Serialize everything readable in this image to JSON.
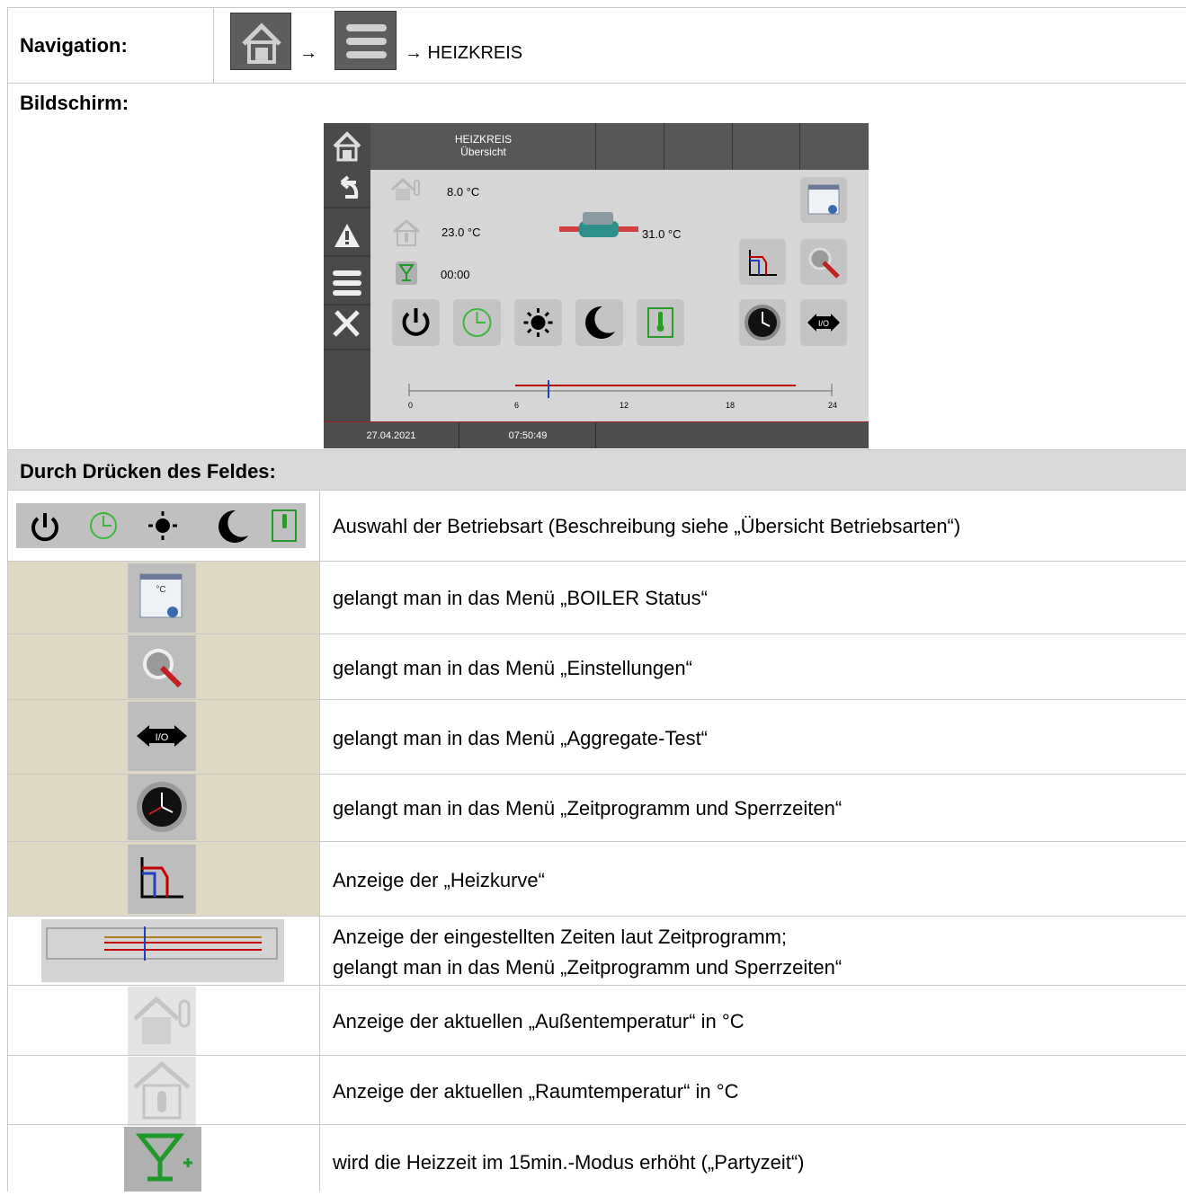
{
  "navigation": {
    "label": "Navigation:",
    "icons": [
      "home-icon",
      "menu-icon"
    ],
    "arrow": "→",
    "target": "→ HEIZKREIS"
  },
  "screen": {
    "label": "Bildschirm:",
    "title_line1": "HEIZKREIS",
    "title_line2": "Übersicht",
    "outside_temp": "8.0  °C",
    "room_temp": "23.0  °C",
    "flow_temp": "31.0 °C",
    "party_time": "00:00",
    "date": "27.04.2021",
    "time": "07:50:49",
    "timeline_ticks": [
      "0",
      "6",
      "12",
      "18",
      "24"
    ],
    "side_icons": [
      "home-icon",
      "back-icon",
      "warning-icon",
      "menu-icon",
      "tools-icon"
    ],
    "mode_icons": [
      "power-icon",
      "clock-auto-icon",
      "sun-icon",
      "moon-icon",
      "thermometer-icon"
    ]
  },
  "section": {
    "label": "Durch Drücken des Feldes:"
  },
  "rows": [
    {
      "icon": "operating-mode-icons",
      "text": "Auswahl der Betriebsart (Beschreibung siehe „Übersicht Betriebsarten“)"
    },
    {
      "icon": "boiler-status-icon",
      "text": "gelangt man in das Menü „BOILER Status“"
    },
    {
      "icon": "settings-icon",
      "text": "gelangt man in das Menü „Einstellungen“"
    },
    {
      "icon": "io-test-icon",
      "text": "gelangt man in das Menü „Aggregate-Test“"
    },
    {
      "icon": "clock-icon",
      "text": "gelangt man in das Menü „Zeitprogramm und Sperrzeiten“"
    },
    {
      "icon": "heating-curve-icon",
      "text": "Anzeige der „Heizkurve“"
    },
    {
      "icon": "timeline-icon",
      "text": "Anzeige der eingestellten Zeiten laut Zeitprogramm;",
      "text2": "gelangt man in das Menü „Zeitprogramm und Sperrzeiten“"
    },
    {
      "icon": "outside-temp-icon",
      "text": "Anzeige der aktuellen „Außentemperatur“ in °C"
    },
    {
      "icon": "room-temp-icon",
      "text": "Anzeige der aktuellen „Raumtemperatur“ in °C"
    },
    {
      "icon": "party-icon",
      "text": "wird die Heizzeit im 15min.-Modus erhöht („Partyzeit“)"
    }
  ],
  "colors": {
    "header_gray": "#d9d9d9",
    "beige": "#ddd9c4",
    "screen_bg": "#d6d6d6",
    "curve_red": "#c00000",
    "curve_blue": "#1f3fbf",
    "party_green": "#2aa02a"
  }
}
